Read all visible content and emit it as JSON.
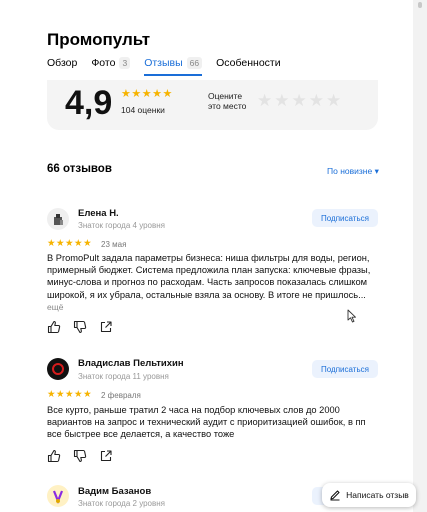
{
  "header": {
    "title": "Промопульт"
  },
  "tabs": [
    {
      "label": "Обзор"
    },
    {
      "label": "Фото",
      "count": "3"
    },
    {
      "label": "Отзывы",
      "count": "66",
      "active": true
    },
    {
      "label": "Особенности"
    }
  ],
  "rating_summary": {
    "value": "4,9",
    "stars": "★★★★★",
    "count_text": "104 оценки",
    "rate_prompt": "Оцените это место",
    "empty_stars": "★★★★★"
  },
  "reviews_section": {
    "heading": "66 отзывов",
    "sort_label": "По новизне ▾"
  },
  "reviews": [
    {
      "name": "Елена Н.",
      "level": "Знаток города 4 уровня",
      "subscribe": "Подписаться",
      "stars": "★★★★★",
      "date": "23 мая",
      "text": "В PromoPult задала параметры бизнеса: ниша фильтры для воды, регион, примерный бюджет. Система предложила план запуска: ключевые фразы, минус-слова и прогноз по расходам. Часть запросов показалась слишком широкой, я их убрала, остальные взяла за основу. В итоге не пришлось...",
      "more": "ещё"
    },
    {
      "name": "Владислав Пельтихин",
      "level": "Знаток города 11 уровня",
      "subscribe": "Подписаться",
      "stars": "★★★★★",
      "date": "2 февраля",
      "text": "Все курто, раньше тратил 2 часа на подбор ключевых слов до 2000 вариантов на запрос и технический аудит с приоритизацией ошибок, в пп все быстрее все делается, а качество тоже"
    },
    {
      "name": "Вадим Базанов",
      "level": "Знаток города 2 уровня",
      "subscribe": "П"
    }
  ],
  "write_review": {
    "label": "Написать отзыв"
  },
  "colors": {
    "accent": "#1a6ed8",
    "star": "#f6b300",
    "subscribe_bg": "#ebf2fd"
  },
  "icons": [
    "thumb-up-icon",
    "thumb-down-icon",
    "share-icon",
    "pencil-icon",
    "cursor-icon"
  ]
}
